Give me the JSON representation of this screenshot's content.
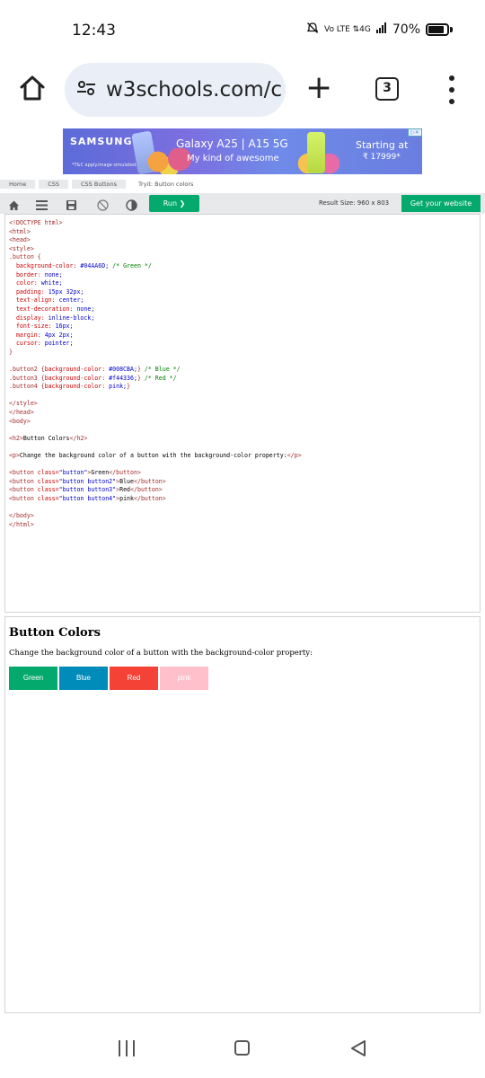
{
  "status": {
    "time": "12:43",
    "network": "Vo LTE ⇅4G",
    "battery": "70%"
  },
  "browser": {
    "url": "w3schools.com/c",
    "tab_count": "3"
  },
  "ad": {
    "brand": "SAMSUNG",
    "title": "Galaxy A25 | A15 5G",
    "subtitle": "My kind of awesome",
    "price_line1": "Starting at",
    "price_line2": "₹ 17999*",
    "disclaimer": "*T&C apply.Image simulated.",
    "choices": "▷✕"
  },
  "breadcrumb": [
    "Home",
    "CSS",
    "CSS Buttons",
    "Tryit: Button colors"
  ],
  "toolbar": {
    "run_label": "Run ❯",
    "result_size": "Result Size: 960 x 803",
    "get_website": "Get your website"
  },
  "code_lines": [
    [
      [
        "t-tag",
        "<!DOCTYPE html>"
      ]
    ],
    [
      [
        "t-tag",
        "<html>"
      ]
    ],
    [
      [
        "t-tag",
        "<head>"
      ]
    ],
    [
      [
        "t-tag",
        "<style>"
      ]
    ],
    [
      [
        "t-sel",
        ".button {"
      ]
    ],
    [
      [
        "t-txt",
        "  "
      ],
      [
        "t-prop",
        "background-color:"
      ],
      [
        "t-val",
        " #04AA6D;"
      ],
      [
        "t-com",
        " /* Green */"
      ]
    ],
    [
      [
        "t-txt",
        "  "
      ],
      [
        "t-prop",
        "border:"
      ],
      [
        "t-val",
        " none;"
      ]
    ],
    [
      [
        "t-txt",
        "  "
      ],
      [
        "t-prop",
        "color:"
      ],
      [
        "t-val",
        " white;"
      ]
    ],
    [
      [
        "t-txt",
        "  "
      ],
      [
        "t-prop",
        "padding:"
      ],
      [
        "t-val",
        " 15px 32px;"
      ]
    ],
    [
      [
        "t-txt",
        "  "
      ],
      [
        "t-prop",
        "text-align:"
      ],
      [
        "t-val",
        " center;"
      ]
    ],
    [
      [
        "t-txt",
        "  "
      ],
      [
        "t-prop",
        "text-decoration:"
      ],
      [
        "t-val",
        " none;"
      ]
    ],
    [
      [
        "t-txt",
        "  "
      ],
      [
        "t-prop",
        "display:"
      ],
      [
        "t-val",
        " inline-block;"
      ]
    ],
    [
      [
        "t-txt",
        "  "
      ],
      [
        "t-prop",
        "font-size:"
      ],
      [
        "t-val",
        " 16px;"
      ]
    ],
    [
      [
        "t-txt",
        "  "
      ],
      [
        "t-prop",
        "margin:"
      ],
      [
        "t-val",
        " 4px 2px;"
      ]
    ],
    [
      [
        "t-txt",
        "  "
      ],
      [
        "t-prop",
        "cursor:"
      ],
      [
        "t-val",
        " pointer;"
      ]
    ],
    [
      [
        "t-sel",
        "}"
      ]
    ],
    [
      [
        "t-txt",
        ""
      ]
    ],
    [
      [
        "t-sel",
        ".button2 {"
      ],
      [
        "t-prop",
        "background-color:"
      ],
      [
        "t-val",
        " #008CBA;"
      ],
      [
        "t-sel",
        "}"
      ],
      [
        "t-com",
        " /* Blue */"
      ]
    ],
    [
      [
        "t-sel",
        ".button3 {"
      ],
      [
        "t-prop",
        "background-color:"
      ],
      [
        "t-val",
        " #f44336;"
      ],
      [
        "t-sel",
        "}"
      ],
      [
        "t-com",
        " /* Red */"
      ]
    ],
    [
      [
        "t-sel",
        ".button4 {"
      ],
      [
        "t-prop",
        "background-color:"
      ],
      [
        "t-val",
        " pink;"
      ],
      [
        "t-sel",
        "}"
      ]
    ],
    [
      [
        "t-txt",
        ""
      ]
    ],
    [
      [
        "t-tag",
        "</style>"
      ]
    ],
    [
      [
        "t-tag",
        "</head>"
      ]
    ],
    [
      [
        "t-tag",
        "<body>"
      ]
    ],
    [
      [
        "t-txt",
        ""
      ]
    ],
    [
      [
        "t-tag",
        "<h2>"
      ],
      [
        "t-txt",
        "Button Colors"
      ],
      [
        "t-tag",
        "</h2>"
      ]
    ],
    [
      [
        "t-txt",
        ""
      ]
    ],
    [
      [
        "t-tag",
        "<p>"
      ],
      [
        "t-txt",
        "Change the background color of a button with the background-color property:"
      ],
      [
        "t-tag",
        "</p>"
      ]
    ],
    [
      [
        "t-txt",
        ""
      ]
    ],
    [
      [
        "t-tag",
        "<button "
      ],
      [
        "t-att",
        "class="
      ],
      [
        "t-val",
        "\"button\""
      ],
      [
        "t-tag",
        ">"
      ],
      [
        "t-txt",
        "Green"
      ],
      [
        "t-tag",
        "</button>"
      ]
    ],
    [
      [
        "t-tag",
        "<button "
      ],
      [
        "t-att",
        "class="
      ],
      [
        "t-val",
        "\"button button2\""
      ],
      [
        "t-tag",
        ">"
      ],
      [
        "t-txt",
        "Blue"
      ],
      [
        "t-tag",
        "</button>"
      ]
    ],
    [
      [
        "t-tag",
        "<button "
      ],
      [
        "t-att",
        "class="
      ],
      [
        "t-val",
        "\"button button3\""
      ],
      [
        "t-tag",
        ">"
      ],
      [
        "t-txt",
        "Red"
      ],
      [
        "t-tag",
        "</button>"
      ]
    ],
    [
      [
        "t-tag",
        "<button "
      ],
      [
        "t-att",
        "class="
      ],
      [
        "t-val",
        "\"button button4\""
      ],
      [
        "t-tag",
        ">"
      ],
      [
        "t-txt",
        "pink"
      ],
      [
        "t-tag",
        "</button>"
      ]
    ],
    [
      [
        "t-txt",
        ""
      ]
    ],
    [
      [
        "t-tag",
        "</body>"
      ]
    ],
    [
      [
        "t-tag",
        "</html>"
      ]
    ]
  ],
  "result": {
    "heading": "Button Colors",
    "description": "Change the background color of a button with the background-color property:",
    "buttons": [
      {
        "label": "Green",
        "color": "#04AA6D"
      },
      {
        "label": "Blue",
        "color": "#008CBA"
      },
      {
        "label": "Red",
        "color": "#f44336"
      },
      {
        "label": "pink",
        "color": "#ffc0cb"
      }
    ]
  },
  "colors": {
    "accent": "#04aa6d",
    "toolbar_bg": "#e7e9eb",
    "url_pill": "#e9eef7"
  }
}
